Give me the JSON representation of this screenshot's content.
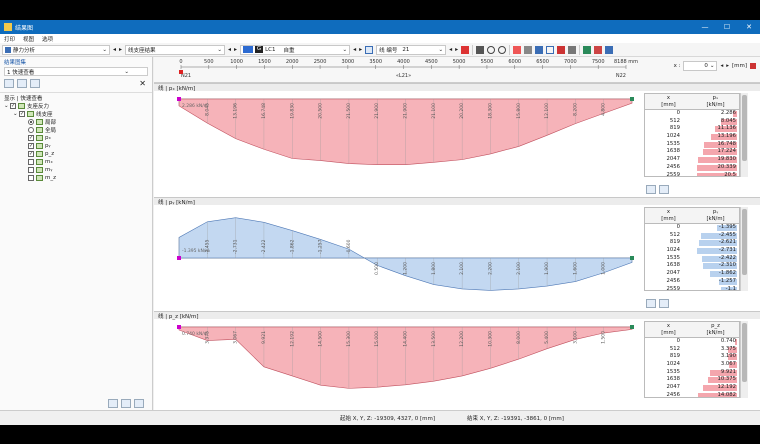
{
  "window": {
    "title": "结果图",
    "minimize": "—",
    "maximize": "☐",
    "close": "✕"
  },
  "menu": [
    "打印",
    "视图",
    "选项"
  ],
  "toolbar": {
    "analysis": "静力分析",
    "result_type": "线支座结果",
    "lc_label": "LC1",
    "lc_name": "自重",
    "line_label": "线 编号",
    "line_no": "21"
  },
  "left": {
    "title": "结果图集",
    "selector": "1  快速查看",
    "tree_header": "显示 | 快速查看",
    "tree": [
      {
        "label": "支座反力",
        "indent": 0,
        "box": "cb",
        "on": true
      },
      {
        "label": "线支座",
        "indent": 1,
        "box": "cb",
        "on": true
      },
      {
        "label": "局部",
        "indent": 2,
        "box": "rad",
        "on": true
      },
      {
        "label": "全局",
        "indent": 2,
        "box": "rad",
        "on": false
      },
      {
        "label": "pₓ",
        "indent": 2,
        "box": "cb",
        "on": true
      },
      {
        "label": "pᵧ",
        "indent": 2,
        "box": "cb",
        "on": true
      },
      {
        "label": "p_z",
        "indent": 2,
        "box": "cb",
        "on": true
      },
      {
        "label": "mₓ",
        "indent": 2,
        "box": "cb",
        "on": false
      },
      {
        "label": "mᵧ",
        "indent": 2,
        "box": "cb",
        "on": false
      },
      {
        "label": "m_z",
        "indent": 2,
        "box": "cb",
        "on": false
      }
    ]
  },
  "ruler": {
    "ticks": [
      "0",
      "500",
      "1000",
      "1500",
      "2000",
      "2500",
      "3000",
      "3500",
      "4000",
      "4500",
      "5000",
      "5500",
      "6000",
      "6500",
      "7000",
      "7500",
      "8188 mm"
    ],
    "start_node": "N21",
    "end_node": "N22",
    "member": "«L21»",
    "x_label": "x :",
    "x_value": "0",
    "x_unit": "[mm]"
  },
  "charts": [
    {
      "title": "线 | pₓ [kN/m]",
      "start_label": "2.286 kN/m",
      "color": "#f4a6ad",
      "stroke": "#c0505e",
      "col_x": "x\n[mm]",
      "col_v": "pₓ\n[kN/m]",
      "rows": [
        [
          "0",
          "2.286"
        ],
        [
          "512",
          "8.045"
        ],
        [
          "819",
          "11.136"
        ],
        [
          "1024",
          "13.196"
        ],
        [
          "1535",
          "16.748"
        ],
        [
          "1638",
          "17.224"
        ],
        [
          "2047",
          "19.830"
        ],
        [
          "2456",
          "20.339"
        ],
        [
          "2559",
          "20.5"
        ]
      ],
      "chart_data": {
        "type": "area",
        "x": [
          0,
          512,
          1024,
          1535,
          2047,
          2559,
          3071,
          3583,
          4094,
          4606,
          5118,
          5629,
          6141,
          6653,
          7165,
          7676,
          8188
        ],
        "values": [
          2.286,
          8.045,
          13.196,
          16.748,
          19.83,
          20.5,
          21.5,
          21.9,
          21.9,
          21.1,
          20.2,
          18.3,
          15.8,
          12.1,
          8.2,
          4.8,
          1.4
        ]
      }
    },
    {
      "title": "线 | pᵧ [kN/m]",
      "start_label": "-1.395 kN/m",
      "color": "#b8d1ee",
      "stroke": "#4f79b6",
      "col_x": "x\n[mm]",
      "col_v": "pᵧ\n[kN/m]",
      "rows": [
        [
          "0",
          "-1.395"
        ],
        [
          "512",
          "-2.455"
        ],
        [
          "819",
          "-2.621"
        ],
        [
          "1024",
          "-2.731"
        ],
        [
          "1535",
          "-2.422"
        ],
        [
          "1638",
          "-2.310"
        ],
        [
          "2047",
          "-1.862"
        ],
        [
          "2456",
          "-1.257"
        ],
        [
          "2559",
          "-1.1"
        ]
      ],
      "chart_data": {
        "type": "area",
        "x": [
          0,
          512,
          1024,
          1535,
          2047,
          2559,
          3071,
          3583,
          4094,
          4606,
          5118,
          5629,
          6141,
          6653,
          7165,
          7676,
          8188
        ],
        "values": [
          -1.395,
          -2.455,
          -2.731,
          -2.422,
          -1.862,
          -1.257,
          -0.6,
          0.5,
          1.2,
          1.8,
          2.1,
          2.2,
          2.1,
          1.9,
          1.6,
          1.0,
          0.3
        ]
      }
    },
    {
      "title": "线 | p_z [kN/m]",
      "start_label": "0.740 kN/m",
      "color": "#f4a6ad",
      "stroke": "#c0505e",
      "col_x": "x\n[mm]",
      "col_v": "p_z\n[kN/m]",
      "rows": [
        [
          "0",
          "0.740"
        ],
        [
          "512",
          "3.375"
        ],
        [
          "819",
          "3.190"
        ],
        [
          "1024",
          "3.067"
        ],
        [
          "1535",
          "9.921"
        ],
        [
          "1638",
          "10.375"
        ],
        [
          "2047",
          "12.192"
        ],
        [
          "2456",
          "14.082"
        ],
        [
          "2559",
          "14.5"
        ]
      ],
      "chart_data": {
        "type": "area",
        "x": [
          0,
          512,
          1024,
          1535,
          2047,
          2559,
          3071,
          3583,
          4094,
          4606,
          5118,
          5629,
          6141,
          6653,
          7165,
          7676,
          8188
        ],
        "values": [
          0.74,
          3.375,
          3.067,
          9.921,
          12.192,
          14.5,
          15.3,
          15.0,
          14.4,
          13.5,
          12.2,
          10.3,
          8.0,
          5.4,
          3.1,
          1.5,
          0.6
        ]
      }
    }
  ],
  "status": {
    "start": "起始 X, Y, Z: -19309, 4327, 0 [mm]",
    "end": "结束 X, Y, Z: -19391, -3861, 0 [mm]"
  }
}
